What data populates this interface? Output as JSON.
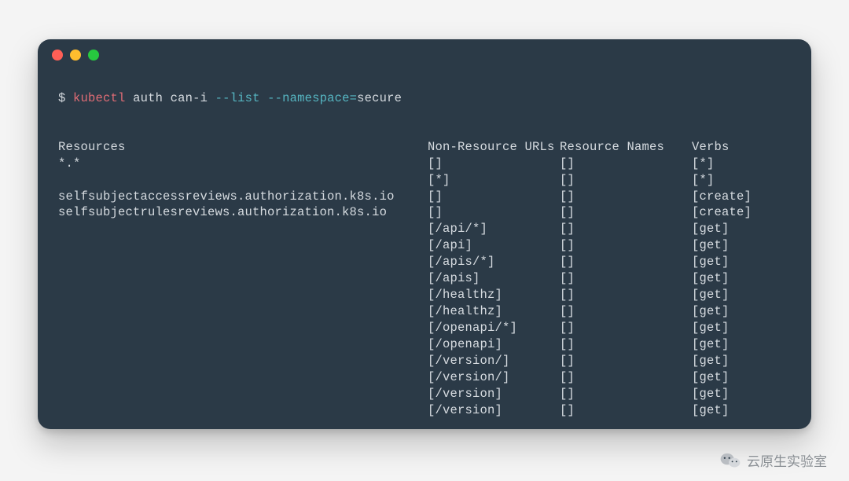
{
  "command": {
    "prompt": "$",
    "binary": "kubectl",
    "args_plain1": "auth can-i",
    "flag1": "--list",
    "flag2": "--namespace=",
    "value2": "secure"
  },
  "headers": {
    "resources": "Resources",
    "non_resource_urls": "Non-Resource URLs",
    "resource_names": "Resource Names",
    "verbs": "Verbs"
  },
  "rows": [
    {
      "resources": "*.*",
      "non_resource_urls": "[]",
      "resource_names": "[]",
      "verbs": "[*]"
    },
    {
      "resources": "",
      "non_resource_urls": "[*]",
      "resource_names": "[]",
      "verbs": "[*]"
    },
    {
      "resources": "selfsubjectaccessreviews.authorization.k8s.io",
      "non_resource_urls": "[]",
      "resource_names": "[]",
      "verbs": "[create]"
    },
    {
      "resources": "selfsubjectrulesreviews.authorization.k8s.io",
      "non_resource_urls": "[]",
      "resource_names": "[]",
      "verbs": "[create]"
    },
    {
      "resources": "",
      "non_resource_urls": "[/api/*]",
      "resource_names": "[]",
      "verbs": "[get]"
    },
    {
      "resources": "",
      "non_resource_urls": "[/api]",
      "resource_names": "[]",
      "verbs": "[get]"
    },
    {
      "resources": "",
      "non_resource_urls": "[/apis/*]",
      "resource_names": "[]",
      "verbs": "[get]"
    },
    {
      "resources": "",
      "non_resource_urls": "[/apis]",
      "resource_names": "[]",
      "verbs": "[get]"
    },
    {
      "resources": "",
      "non_resource_urls": "[/healthz]",
      "resource_names": "[]",
      "verbs": "[get]"
    },
    {
      "resources": "",
      "non_resource_urls": "[/healthz]",
      "resource_names": "[]",
      "verbs": "[get]"
    },
    {
      "resources": "",
      "non_resource_urls": "[/openapi/*]",
      "resource_names": "[]",
      "verbs": "[get]"
    },
    {
      "resources": "",
      "non_resource_urls": "[/openapi]",
      "resource_names": "[]",
      "verbs": "[get]"
    },
    {
      "resources": "",
      "non_resource_urls": "[/version/]",
      "resource_names": "[]",
      "verbs": "[get]"
    },
    {
      "resources": "",
      "non_resource_urls": "[/version/]",
      "resource_names": "[]",
      "verbs": "[get]"
    },
    {
      "resources": "",
      "non_resource_urls": "[/version]",
      "resource_names": "[]",
      "verbs": "[get]"
    },
    {
      "resources": "",
      "non_resource_urls": "[/version]",
      "resource_names": "[]",
      "verbs": "[get]"
    }
  ],
  "watermark": {
    "text": "云原生实验室",
    "icon": "wechat-icon"
  }
}
